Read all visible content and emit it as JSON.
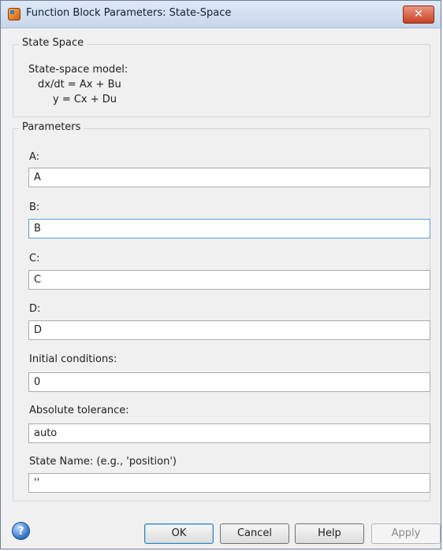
{
  "window": {
    "title": "Function Block Parameters: State-Space",
    "close_symbol": "✕"
  },
  "description": {
    "group_title": "State Space",
    "line1": "State-space model:",
    "line2": "dx/dt = Ax + Bu",
    "line3": "y = Cx + Du"
  },
  "parameters": {
    "group_title": "Parameters",
    "fields": [
      {
        "label": "A:",
        "value": "A"
      },
      {
        "label": "B:",
        "value": "B"
      },
      {
        "label": "C:",
        "value": "C"
      },
      {
        "label": "D:",
        "value": "D"
      },
      {
        "label": "Initial conditions:",
        "value": "0"
      },
      {
        "label": "Absolute tolerance:",
        "value": "auto"
      },
      {
        "label": "State Name: (e.g., 'position')",
        "value": "''"
      }
    ]
  },
  "footer": {
    "help_symbol": "?",
    "ok_label": "OK",
    "cancel_label": "Cancel",
    "help_label": "Help",
    "apply_label": "Apply"
  },
  "icons": {
    "app_icon": "simulink-block-icon",
    "help_icon": "help-circle-icon",
    "close_icon": "close-icon"
  },
  "colors": {
    "titlebar": "#c7d7ea",
    "close_button": "#c84124",
    "dialog_background": "#f0f0f0",
    "focused_field_border": "#5c9cd6"
  }
}
